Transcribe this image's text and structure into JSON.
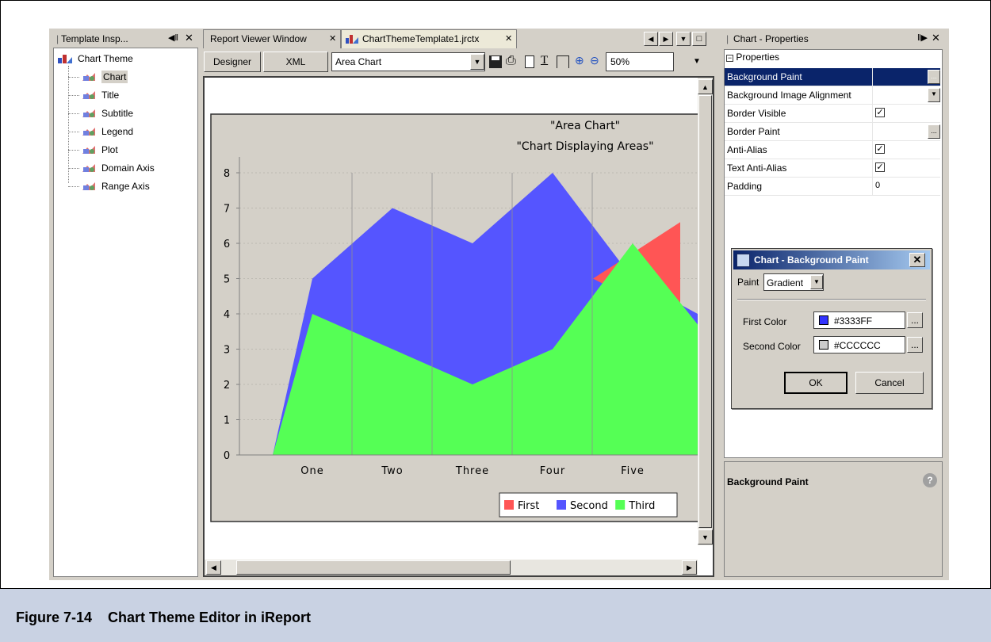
{
  "left_panel": {
    "title": "Template Insp...",
    "tree": {
      "root": "Chart Theme",
      "items": [
        "Chart",
        "Title",
        "Subtitle",
        "Legend",
        "Plot",
        "Domain Axis",
        "Range Axis"
      ]
    }
  },
  "center": {
    "tabs": [
      "Report Viewer Window",
      "ChartThemeTemplate1.jrctx"
    ],
    "toolbar": {
      "designer_label": "Designer",
      "xml_label": "XML",
      "chart_type": "Area Chart",
      "zoom": "50%"
    }
  },
  "chart_data": {
    "type": "area",
    "title": "\"Area Chart\"",
    "subtitle": "\"Chart Displaying Areas\"",
    "categories": [
      "One",
      "Two",
      "Three",
      "Four",
      "Five"
    ],
    "ylim": [
      0,
      8
    ],
    "y_ticks": [
      "0",
      "1",
      "2",
      "3",
      "4",
      "5",
      "6",
      "7",
      "8"
    ],
    "series": [
      {
        "name": "First",
        "color": "#ff5555",
        "values": [
          0,
          0,
          0,
          0,
          5,
          6.6
        ]
      },
      {
        "name": "Second",
        "color": "#5555ff",
        "values": [
          0,
          5,
          7,
          6,
          8,
          5,
          4
        ]
      },
      {
        "name": "Third",
        "color": "#55ff55",
        "values": [
          0,
          4,
          3,
          2,
          3,
          6,
          3.7
        ]
      }
    ],
    "legend": "bottom-right"
  },
  "right_panel": {
    "title": "Chart - Properties",
    "section": "Properties",
    "rows": [
      {
        "key": "Background Paint",
        "value": ""
      },
      {
        "key": "Background Image Alignment",
        "value": ""
      },
      {
        "key": "Border Visible",
        "value": "checked"
      },
      {
        "key": "Border Paint",
        "value": ""
      },
      {
        "key": "Anti-Alias",
        "value": "checked"
      },
      {
        "key": "Text Anti-Alias",
        "value": "checked"
      },
      {
        "key": "Padding",
        "value": "0"
      }
    ],
    "description_title": "Background Paint"
  },
  "dialog": {
    "title": "Chart - Background Paint",
    "paint_label": "Paint",
    "paint_value": "Gradient",
    "first_color_label": "First Color",
    "first_color": "#3333FF",
    "second_color_label": "Second Color",
    "second_color": "#CCCCCC",
    "ok": "OK",
    "cancel": "Cancel",
    "dots": "..."
  },
  "caption": "Figure 7-14    Chart Theme Editor in iReport"
}
